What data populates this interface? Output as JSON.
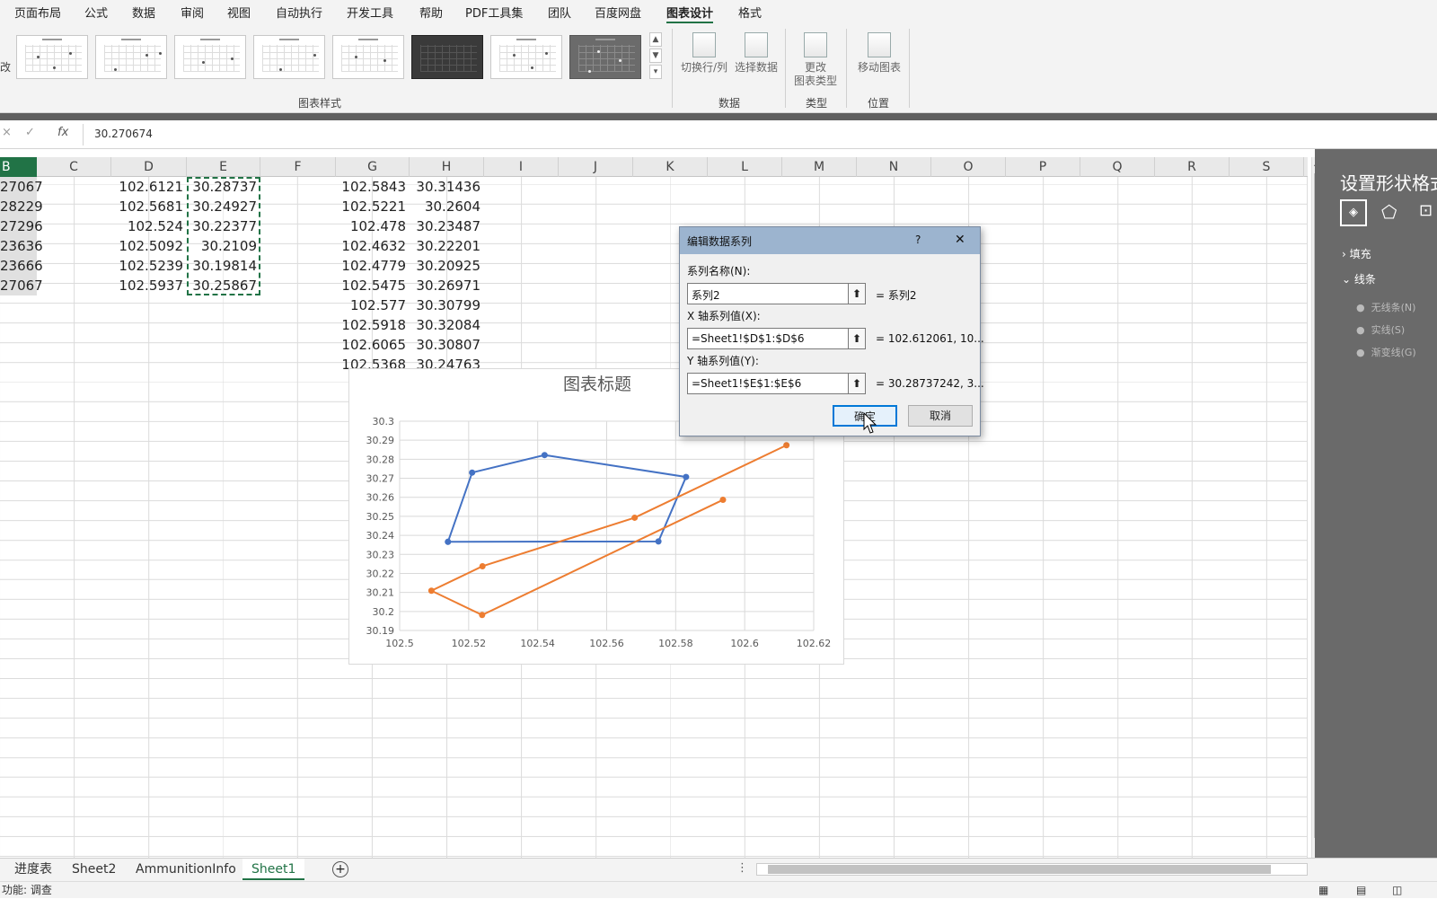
{
  "ribbon": {
    "tabs": [
      "页面布局",
      "公式",
      "数据",
      "审阅",
      "视图",
      "自动执行",
      "开发工具",
      "帮助",
      "PDF工具集",
      "团队",
      "百度网盘",
      "图表设计",
      "格式"
    ],
    "active_tab": "图表设计",
    "left_stub": "改",
    "groups": {
      "styles": "图表样式",
      "data": "数据",
      "type": "类型",
      "location": "位置"
    },
    "buttons": {
      "switch_row_col": "切换行/列",
      "select_data": "选择数据",
      "change_type_1": "更改",
      "change_type_2": "图表类型",
      "move_chart": "移动图表"
    }
  },
  "formula": {
    "value": "30.270674",
    "fx": "fx"
  },
  "columns": [
    "B",
    "C",
    "D",
    "E",
    "F",
    "G",
    "H",
    "I",
    "J",
    "K",
    "L",
    "M",
    "N",
    "O",
    "P",
    "Q",
    "R",
    "S"
  ],
  "cells": {
    "B": [
      "27067",
      "28229",
      "27296",
      "23636",
      "23666",
      "27067"
    ],
    "D": [
      "102.6121",
      "102.5681",
      "102.524",
      "102.5092",
      "102.5239",
      "102.5937"
    ],
    "E": [
      "30.28737",
      "30.24927",
      "30.22377",
      "30.2109",
      "30.19814",
      "30.25867"
    ],
    "G": [
      "102.5843",
      "102.5221",
      "102.478",
      "102.4632",
      "102.4779",
      "102.5475",
      "102.577",
      "102.5918",
      "102.6065",
      "102.5368"
    ],
    "H": [
      "30.31436",
      "30.2604",
      "30.23487",
      "30.22201",
      "30.20925",
      "30.26971",
      "30.30799",
      "30.32084",
      "30.30807",
      "30.24763"
    ]
  },
  "dialog": {
    "title": "编辑数据系列",
    "help": "?",
    "close": "✕",
    "name_label": "系列名称(N):",
    "name_value": "系列2",
    "name_preview": "= 系列2",
    "x_label": "X 轴系列值(X):",
    "x_value": "=Sheet1!$D$1:$D$6",
    "x_preview": "= 102.612061, 10...",
    "y_label": "Y 轴系列值(Y):",
    "y_value": "=Sheet1!$E$1:$E$6",
    "y_preview": "= 30.28737242, 3...",
    "ok": "确定",
    "cancel": "取消"
  },
  "chart_data": {
    "type": "scatter",
    "title": "图表标题",
    "xlim": [
      102.5,
      102.62
    ],
    "ylim": [
      30.19,
      30.3
    ],
    "x_ticks": [
      "102.5",
      "102.52",
      "102.54",
      "102.56",
      "102.58",
      "102.6",
      "102.62"
    ],
    "y_ticks": [
      "30.3",
      "30.29",
      "30.28",
      "30.27",
      "30.26",
      "30.25",
      "30.24",
      "30.23",
      "30.22",
      "30.21",
      "30.2",
      "30.19"
    ],
    "grid": true,
    "series": [
      {
        "color": "#4472c4",
        "x": [
          102.514,
          102.521,
          102.542,
          102.583,
          102.575,
          102.514
        ],
        "y": [
          30.2366,
          30.273,
          30.2822,
          30.2707,
          30.2368,
          30.2366
        ]
      },
      {
        "color": "#ed7d31",
        "x": [
          102.6121,
          102.5681,
          102.524,
          102.5092,
          102.5239,
          102.5937
        ],
        "y": [
          30.28737,
          30.24927,
          30.22377,
          30.2109,
          30.19814,
          30.25867
        ]
      }
    ]
  },
  "pane": {
    "title": "设置形状格式",
    "fill": "填充",
    "line": "线条",
    "opt_none": "无线条(N)",
    "opt_solid": "实线(S)",
    "opt_grad": "渐变线(G)"
  },
  "sheets": [
    "进度表",
    "Sheet2",
    "AmmunitionInfo",
    "Sheet1"
  ],
  "active_sheet": "Sheet1",
  "status": "功能: 调查",
  "colors": {
    "accent": "#217346",
    "series1": "#4472c4",
    "series2": "#ed7d31"
  }
}
